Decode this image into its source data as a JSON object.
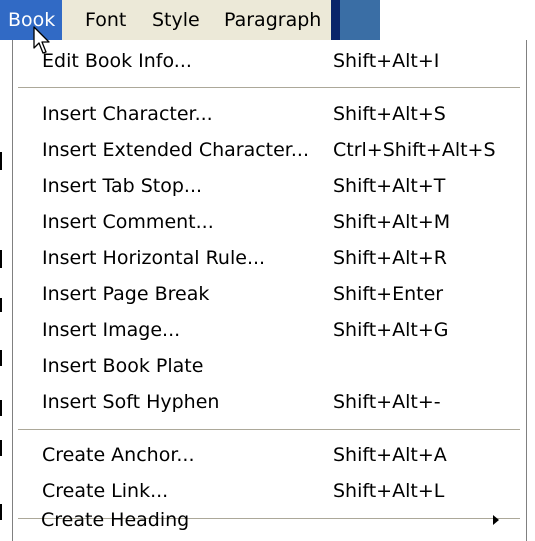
{
  "menubar": {
    "items": [
      {
        "label": "Book"
      },
      {
        "label": "Font"
      },
      {
        "label": "Style"
      },
      {
        "label": "Paragraph"
      }
    ]
  },
  "dropdown": {
    "items": [
      {
        "label": "Edit Book Info...",
        "shortcut": "Shift+Alt+I"
      },
      {
        "label": "Insert Character...",
        "shortcut": "Shift+Alt+S"
      },
      {
        "label": "Insert Extended Character...",
        "shortcut": "Ctrl+Shift+Alt+S"
      },
      {
        "label": "Insert Tab Stop...",
        "shortcut": "Shift+Alt+T"
      },
      {
        "label": "Insert Comment...",
        "shortcut": "Shift+Alt+M"
      },
      {
        "label": "Insert Horizontal Rule...",
        "shortcut": "Shift+Alt+R"
      },
      {
        "label": "Insert Page Break",
        "shortcut": "Shift+Enter"
      },
      {
        "label": "Insert Image...",
        "shortcut": "Shift+Alt+G"
      },
      {
        "label": "Insert Book Plate",
        "shortcut": ""
      },
      {
        "label": "Insert Soft Hyphen",
        "shortcut": "Shift+Alt+-"
      },
      {
        "label": "Create Anchor...",
        "shortcut": "Shift+Alt+A"
      },
      {
        "label": "Create Link...",
        "shortcut": "Shift+Alt+L"
      },
      {
        "label": "Create Heading",
        "shortcut": ""
      }
    ]
  },
  "colors": {
    "menu_highlight": "#316ac5",
    "menubar_bg": "#ece9d8",
    "title_blue": "#3a6ea5"
  }
}
